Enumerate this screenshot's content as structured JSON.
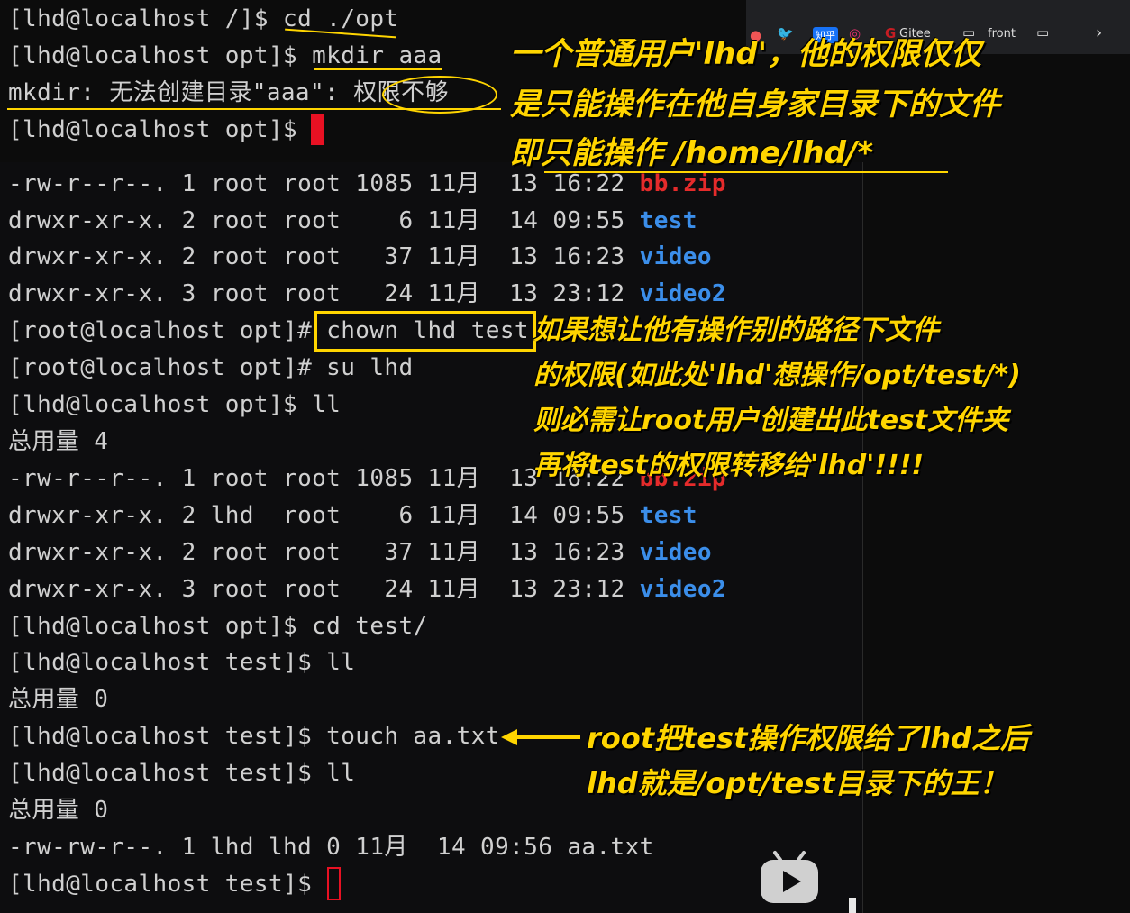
{
  "terminal_top": {
    "lines": [
      "[lhd@localhost /]$ cd ./opt",
      "[lhd@localhost opt]$ mkdir aaa",
      "mkdir: 无法创建目录\"aaa\": 权限不够",
      "[lhd@localhost opt]$ "
    ]
  },
  "terminal_main": {
    "listing1": [
      {
        "perm": "-rw-r--r--. 1 root root 1085 11月  13 16:22 ",
        "name": "bb.zip",
        "kind": "archive"
      },
      {
        "perm": "drwxr-xr-x. 2 root root    6 11月  14 09:55 ",
        "name": "test",
        "kind": "dir"
      },
      {
        "perm": "drwxr-xr-x. 2 root root   37 11月  13 16:23 ",
        "name": "video",
        "kind": "dir"
      },
      {
        "perm": "drwxr-xr-x. 3 root root   24 11月  13 23:12 ",
        "name": "video2",
        "kind": "dir"
      }
    ],
    "chown_prompt": "[root@localhost opt]# ",
    "chown_cmd": "chown lhd test",
    "su_line": "[root@localhost opt]# su lhd",
    "ll_line1": "[lhd@localhost opt]$ ll",
    "total1": "总用量 4",
    "listing2": [
      {
        "perm": "-rw-r--r--. 1 root root 1085 11月  13 16:22 ",
        "name": "bb.zip",
        "kind": "archive"
      },
      {
        "perm": "drwxr-xr-x. 2 lhd  root    6 11月  14 09:55 ",
        "name": "test",
        "kind": "dir"
      },
      {
        "perm": "drwxr-xr-x. 2 root root   37 11月  13 16:23 ",
        "name": "video",
        "kind": "dir"
      },
      {
        "perm": "drwxr-xr-x. 3 root root   24 11月  13 23:12 ",
        "name": "video2",
        "kind": "dir"
      }
    ],
    "cd_line": "[lhd@localhost opt]$ cd test/",
    "ll_line2": "[lhd@localhost test]$ ll",
    "total2": "总用量 0",
    "touch_line": "[lhd@localhost test]$ touch aa.txt",
    "ll_line3": "[lhd@localhost test]$ ll",
    "total3": "总用量 0",
    "file_line": "-rw-rw-r--. 1 lhd lhd 0 11月  14 09:56 aa.txt",
    "final_prompt": "[lhd@localhost test]$ "
  },
  "annotations": {
    "top": [
      "一个普通用户'lhd'，他的权限仅仅",
      "是只能操作在他自身家目录下的文件",
      "即只能操作 /home/lhd/*"
    ],
    "middle": [
      "如果想让他有操作别的路径下文件",
      "的权限(如此处'lhd'想操作/opt/test/*)",
      "则必需让root用户创建出此test文件夹",
      "再将test的权限转移给'lhd'!!!!"
    ],
    "bottom": [
      "root把test操作权限给了lhd之后",
      "lhd就是/opt/test目录下的王！"
    ]
  },
  "browser_bar": {
    "bookmarks": [
      "知乎",
      "Gitee",
      "front"
    ]
  },
  "colors": {
    "annotation": "#ffd500",
    "dir_name": "#3b8eea",
    "archive_name": "#e52b2b",
    "cursor": "#e81123"
  }
}
